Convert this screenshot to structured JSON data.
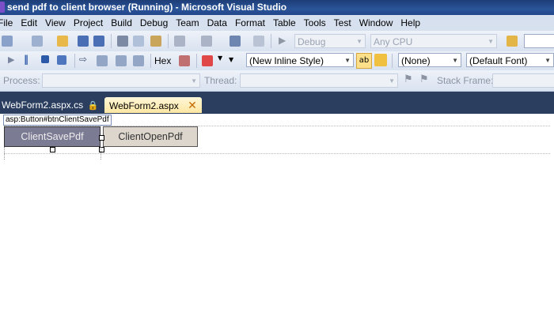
{
  "window": {
    "title": "send pdf to client browser (Running) - Microsoft Visual Studio"
  },
  "menu": [
    "File",
    "Edit",
    "View",
    "Project",
    "Build",
    "Debug",
    "Team",
    "Data",
    "Format",
    "Table",
    "Tools",
    "Test",
    "Window",
    "Help"
  ],
  "toolbar1": {
    "config": "Debug",
    "platform": "Any CPU"
  },
  "toolbar2": {
    "hex_label": "Hex",
    "style": "(New Inline Style)",
    "target_rule": "(None)",
    "font": "(Default Font)"
  },
  "toolbar3": {
    "process_label": "Process:",
    "thread_label": "Thread:",
    "stack_label": "Stack Frame:"
  },
  "tabs": [
    {
      "label": "WebForm2.aspx.cs"
    },
    {
      "label": "WebForm2.aspx"
    }
  ],
  "designer": {
    "tag_tooltip": "asp:Button#btnClientSavePdf",
    "buttons": [
      {
        "label": "ClientSavePdf"
      },
      {
        "label": "ClientOpenPdf"
      }
    ]
  }
}
